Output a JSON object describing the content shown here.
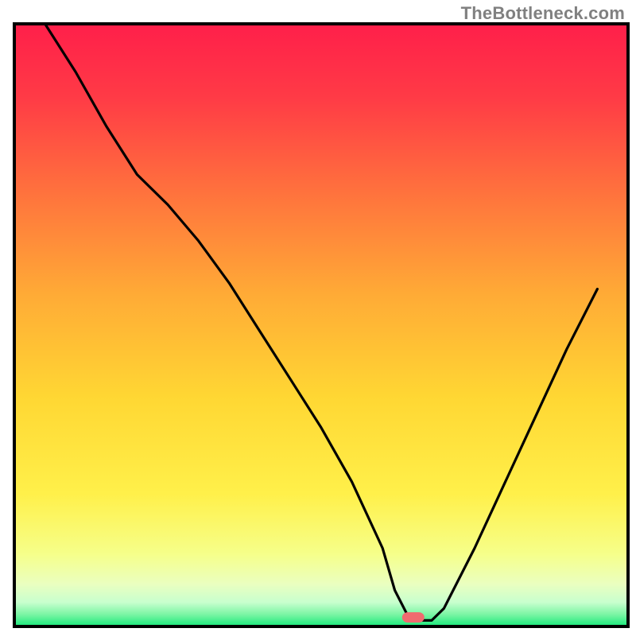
{
  "watermark": "TheBottleneck.com",
  "chart_data": {
    "type": "line",
    "title": "",
    "xlabel": "",
    "ylabel": "",
    "xlim": [
      0,
      100
    ],
    "ylim": [
      0,
      100
    ],
    "grid": false,
    "legend": false,
    "background_gradient": {
      "top": "#ff1f4a",
      "upper_mid": "#ff8b33",
      "mid": "#ffd733",
      "lower_mid": "#f6ff66",
      "pale": "#f3ffc9",
      "bottom": "#17e87a"
    },
    "markers": [
      {
        "name": "optimal-point",
        "x": 65,
        "y": 1.5,
        "color": "#f06b6f"
      }
    ],
    "series": [
      {
        "name": "bottleneck-curve",
        "color": "#000000",
        "x": [
          5,
          10,
          15,
          20,
          25,
          30,
          35,
          40,
          45,
          50,
          55,
          60,
          62,
          64,
          66,
          68,
          70,
          75,
          80,
          85,
          90,
          95
        ],
        "y": [
          100,
          92,
          83,
          75,
          70,
          64,
          57,
          49,
          41,
          33,
          24,
          13,
          6,
          2,
          1,
          1,
          3,
          13,
          24,
          35,
          46,
          56
        ]
      }
    ]
  }
}
